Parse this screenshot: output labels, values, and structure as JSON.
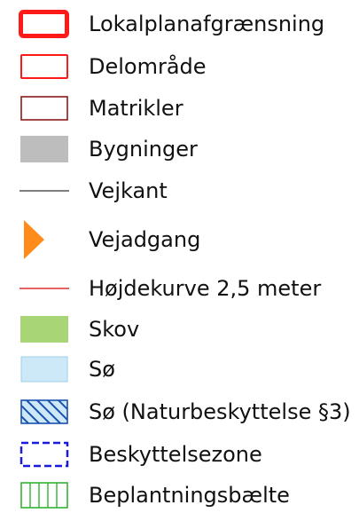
{
  "legend": {
    "items": [
      {
        "label": "Lokalplanafgrænsning",
        "icon": "thick-red-outline-rect-icon",
        "color": "#ff1a1a"
      },
      {
        "label": "Delområde",
        "icon": "red-outline-rect-icon",
        "color": "#ff1a1a"
      },
      {
        "label": "Matrikler",
        "icon": "dark-red-outline-rect-icon",
        "color": "#8b1a1a"
      },
      {
        "label": "Bygninger",
        "icon": "gray-filled-rect-icon",
        "color": "#bdbdbd"
      },
      {
        "label": "Vejkant",
        "icon": "dark-gray-line-icon",
        "color": "#555555"
      },
      {
        "label": "Vejadgang",
        "icon": "orange-triangle-icon",
        "color": "#ff8c1a"
      },
      {
        "label": "Højdekurve 2,5 meter",
        "icon": "red-line-icon",
        "color": "#e03030"
      },
      {
        "label": "Skov",
        "icon": "green-filled-rect-icon",
        "color": "#a8d576"
      },
      {
        "label": "Sø",
        "icon": "light-blue-rect-icon",
        "color": "#cde9f7"
      },
      {
        "label": "Sø (Naturbeskyttelse §3)",
        "icon": "blue-hatched-rect-icon",
        "color": "#1a4fb0"
      },
      {
        "label": "Beskyttelsezone",
        "icon": "blue-dashed-rect-icon",
        "color": "#1a1adb"
      },
      {
        "label": "Beplantningsbælte",
        "icon": "green-vertical-hatch-rect-icon",
        "color": "#33b233"
      }
    ]
  }
}
